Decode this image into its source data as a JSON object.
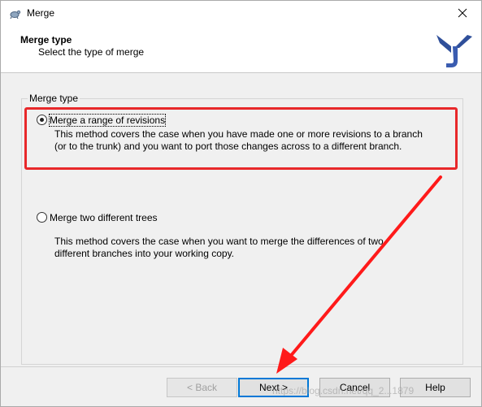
{
  "window": {
    "title": "Merge"
  },
  "header": {
    "title": "Merge type",
    "subtitle": "Select the type of merge"
  },
  "group": {
    "legend": "Merge type"
  },
  "options": [
    {
      "label": "Merge a range of revisions",
      "selected": true,
      "description_line1": "This method covers the case when you have made one or more revisions to a branch",
      "description_line2": "(or to the trunk) and you want to port those changes across to a different branch."
    },
    {
      "label": "Merge two different trees",
      "selected": false,
      "description_line1": "This method covers the case when you want to merge the differences of two",
      "description_line2": "different branches into your working copy."
    }
  ],
  "buttons": {
    "back": "< Back",
    "next": "Next >",
    "cancel": "Cancel",
    "help": "Help"
  },
  "watermark": "https://blog.csdn.net/qq_2...1879",
  "colors": {
    "highlight": "#e8282a",
    "accent": "#0078d7"
  }
}
